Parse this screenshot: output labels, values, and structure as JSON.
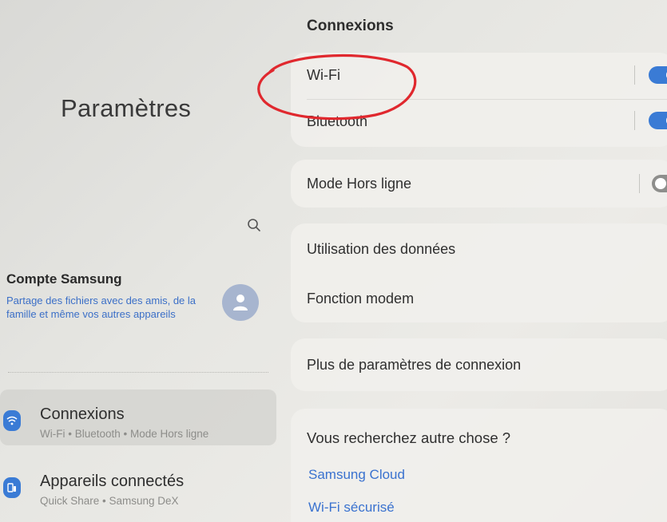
{
  "left": {
    "title": "Paramètres",
    "account": {
      "title": "Compte Samsung",
      "description": "Partage des fichiers avec des amis, de la famille et même vos autres appareils"
    },
    "menu": [
      {
        "label": "Connexions",
        "sub": "Wi-Fi • Bluetooth • Mode Hors ligne",
        "icon": "wifi-icon"
      },
      {
        "label": "Appareils connectés",
        "sub": "Quick Share • Samsung DeX",
        "icon": "devices-icon"
      }
    ]
  },
  "right": {
    "section_title": "Connexions",
    "rows": {
      "wifi": {
        "label": "Wi-Fi",
        "toggle": "on"
      },
      "bluetooth": {
        "label": "Bluetooth",
        "toggle": "on"
      },
      "airplane": {
        "label": "Mode Hors ligne",
        "toggle": "off"
      },
      "data_usage": {
        "label": "Utilisation des données"
      },
      "hotspot": {
        "label": "Fonction modem"
      },
      "more": {
        "label": "Plus de paramètres de connexion"
      }
    },
    "looking": {
      "title": "Vous recherchez autre chose ?",
      "links": [
        "Samsung Cloud",
        "Wi-Fi sécurisé"
      ]
    }
  },
  "colors": {
    "accent": "#3a7bd5",
    "link": "#3a72cf",
    "annotation": "#e0282e"
  }
}
